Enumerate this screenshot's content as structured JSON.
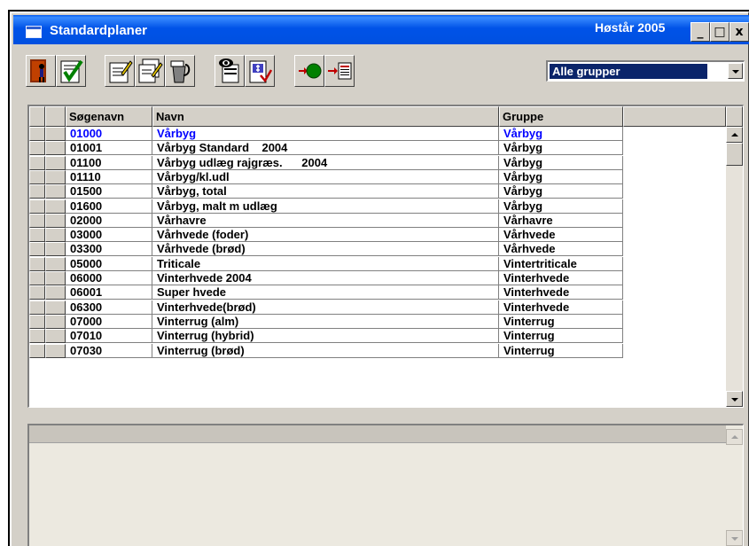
{
  "window": {
    "title": "Standardplaner",
    "harvest_label": "Høstår 2005",
    "controls": {
      "minimize": "_",
      "maximize": "□",
      "close": "x"
    }
  },
  "toolbar": {
    "buttons": [
      {
        "icon": "exit-door-icon"
      },
      {
        "icon": "checklist-approve-icon"
      },
      {
        "icon": "edit-document-icon"
      },
      {
        "icon": "copy-edit-document-icon"
      },
      {
        "icon": "delete-bin-icon"
      },
      {
        "icon": "view-preview-icon"
      },
      {
        "icon": "price-calc-icon"
      },
      {
        "icon": "import-icon"
      },
      {
        "icon": "export-icon"
      }
    ]
  },
  "group_filter": {
    "selected": "Alle grupper"
  },
  "table": {
    "columns": [
      "Søgenavn",
      "Navn",
      "Gruppe",
      ""
    ],
    "rows": [
      {
        "code": "01000",
        "name": "Vårbyg",
        "group": "Vårbyg"
      },
      {
        "code": "01001",
        "name": "Vårbyg Standard    2004",
        "group": "Vårbyg"
      },
      {
        "code": "01100",
        "name": "Vårbyg udlæg rajgræs.      2004",
        "group": "Vårbyg"
      },
      {
        "code": "01110",
        "name": "Vårbyg/kl.udl",
        "group": "Vårbyg"
      },
      {
        "code": "01500",
        "name": "Vårbyg, total",
        "group": "Vårbyg"
      },
      {
        "code": "01600",
        "name": "Vårbyg, malt m udlæg",
        "group": "Vårbyg"
      },
      {
        "code": "02000",
        "name": "Vårhavre",
        "group": "Vårhavre"
      },
      {
        "code": "03000",
        "name": "Vårhvede (foder)",
        "group": "Vårhvede"
      },
      {
        "code": "03300",
        "name": "Vårhvede (brød)",
        "group": "Vårhvede"
      },
      {
        "code": "05000",
        "name": "Triticale",
        "group": "Vintertriticale"
      },
      {
        "code": "06000",
        "name": "Vinterhvede 2004",
        "group": "Vinterhvede"
      },
      {
        "code": "06001",
        "name": "Super hvede",
        "group": "Vinterhvede"
      },
      {
        "code": "06300",
        "name": "Vinterhvede(brød)",
        "group": "Vinterhvede"
      },
      {
        "code": "07000",
        "name": "Vinterrug (alm)",
        "group": "Vinterrug"
      },
      {
        "code": "07010",
        "name": "Vinterrug (hybrid)",
        "group": "Vinterrug"
      },
      {
        "code": "07030",
        "name": "Vinterrug (brød)",
        "group": "Vinterrug"
      }
    ]
  },
  "colors": {
    "titlebar": "#0053e8",
    "selected_row_text": "#0000ff",
    "dropdown_highlight": "#0a246a"
  }
}
